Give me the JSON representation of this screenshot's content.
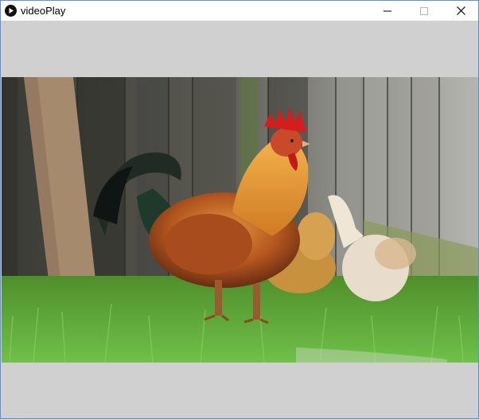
{
  "window": {
    "title": "videoPlay",
    "icons": {
      "app": "play-icon",
      "minimize": "minimize-icon",
      "maximize": "maximize-icon",
      "close": "close-icon"
    }
  },
  "video": {
    "content": "rooster-and-hens-in-grass"
  },
  "colors": {
    "letterbox": "#d0d0d0",
    "window_border": "#5b8fd6",
    "titlebar": "#ffffff"
  }
}
